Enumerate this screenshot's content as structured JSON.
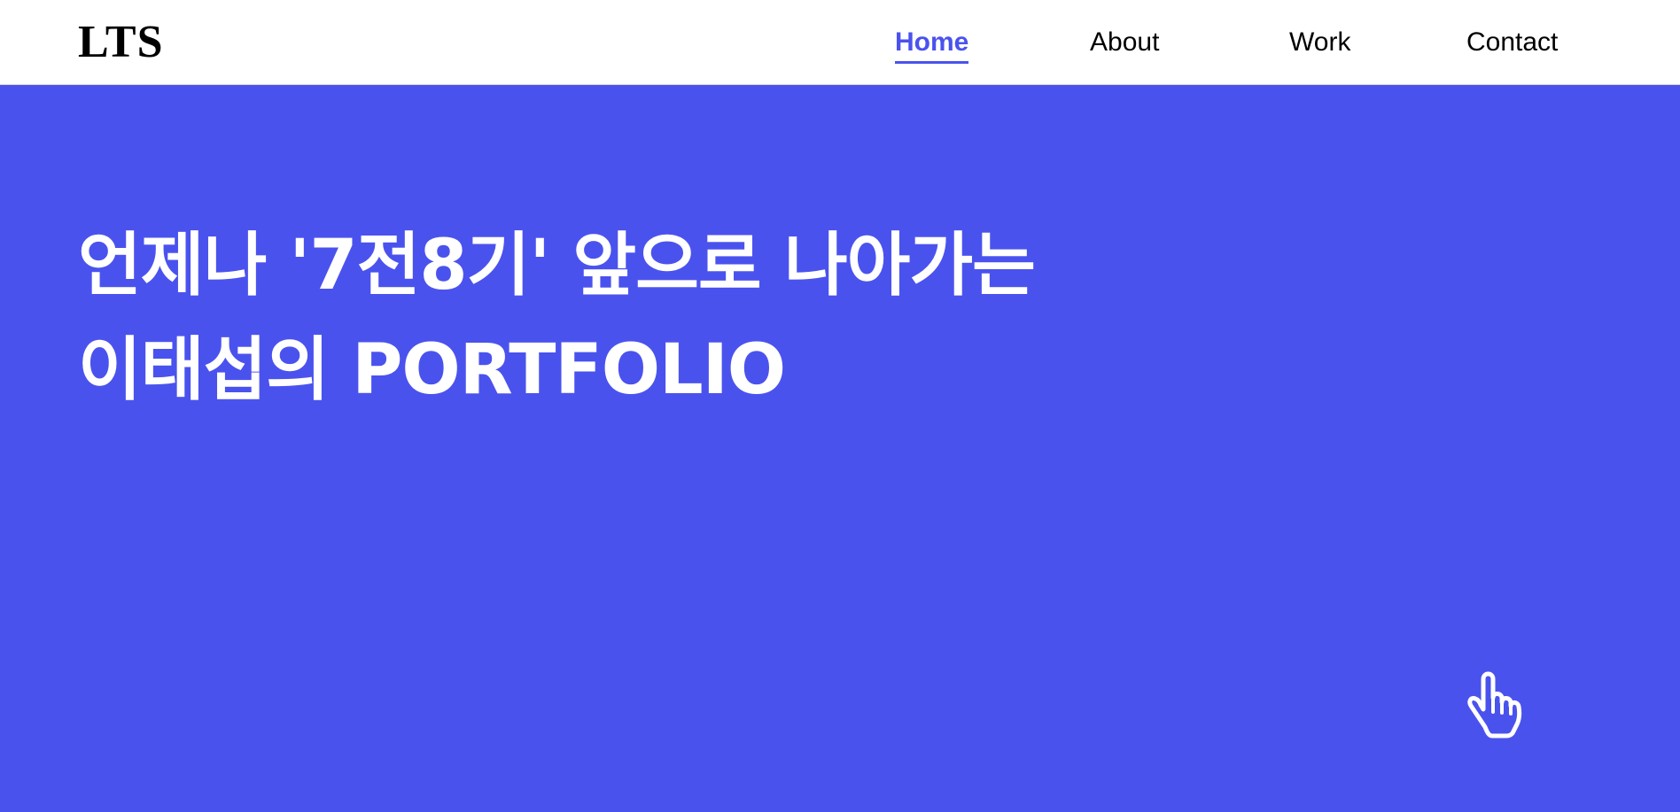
{
  "header": {
    "logo": "LTS",
    "nav": [
      {
        "label": "Home",
        "active": true
      },
      {
        "label": "About",
        "active": false
      },
      {
        "label": "Work",
        "active": false
      },
      {
        "label": "Contact",
        "active": false
      }
    ]
  },
  "hero": {
    "title_line_1": "언제나 '7전8기' 앞으로 나아가는",
    "title_line_2": "이태섭의 PORTFOLIO",
    "scroll_icon": "hand-pointer-icon"
  },
  "colors": {
    "accent": "#4a52ee",
    "background": "#ffffff",
    "hero_text": "#ffffff",
    "nav_text": "#000000"
  }
}
